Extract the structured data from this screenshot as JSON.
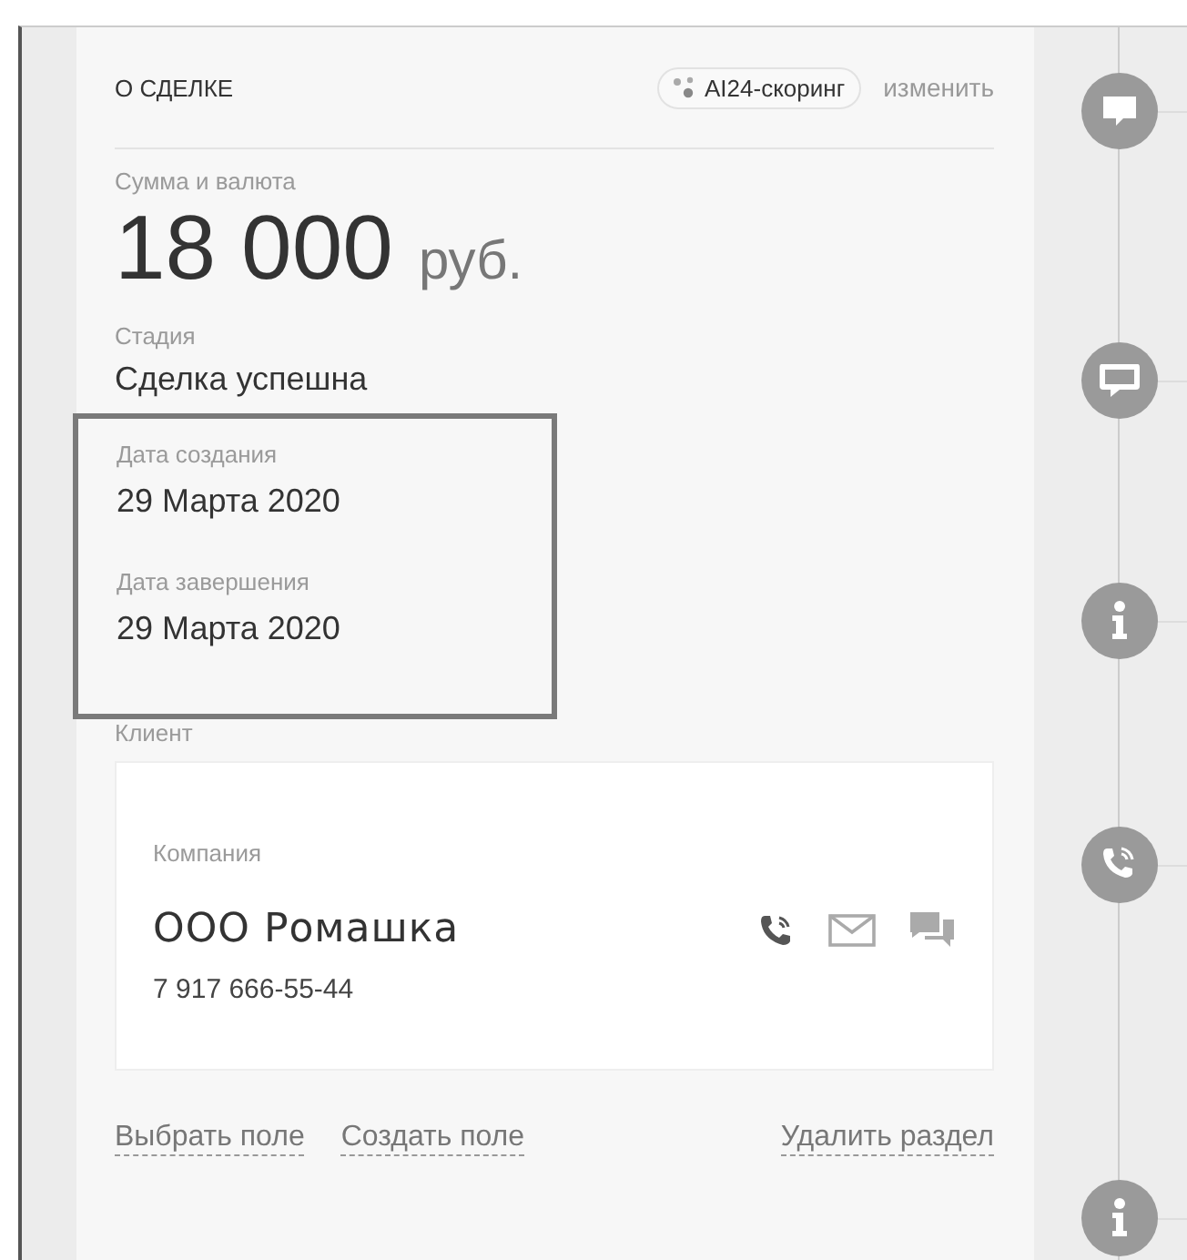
{
  "section": {
    "title": "О СДЕЛКЕ",
    "scoring_badge": "AI24-скоринг",
    "edit_link": "изменить"
  },
  "amount": {
    "label": "Сумма и валюта",
    "value": "18 000",
    "currency": "руб."
  },
  "stage": {
    "label": "Стадия",
    "value": "Сделка успешна"
  },
  "dates": [
    {
      "label": "Дата создания",
      "value": "29 Марта 2020"
    },
    {
      "label": "Дата завершения",
      "value": "29 Марта 2020"
    }
  ],
  "highlighted_dates": true,
  "client": {
    "label": "Клиент",
    "type_label": "Компания",
    "name": "ООО Ромашка",
    "phone": "7 917 666-55-44"
  },
  "footer_links": [
    "Выбрать поле",
    "Создать поле"
  ],
  "delete_link": "Удалить раздел",
  "timeline": [
    {
      "kind": "comment"
    },
    {
      "kind": "chat"
    },
    {
      "kind": "info"
    },
    {
      "kind": "call"
    },
    {
      "kind": "info"
    }
  ]
}
